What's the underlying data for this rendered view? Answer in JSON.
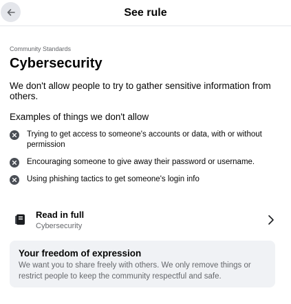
{
  "header": {
    "title": "See rule",
    "back_icon": "arrow-left-icon"
  },
  "rule": {
    "kicker": "Community Standards",
    "title": "Cybersecurity",
    "description": "We don't allow people to try to gather sensitive information from others.",
    "examples_heading": "Examples of things we don't allow",
    "examples": [
      {
        "icon": "x-circle-icon",
        "text": "Trying to get access to someone's accounts or data, with or without permission"
      },
      {
        "icon": "x-circle-icon",
        "text": "Encouraging someone to give away their password or username."
      },
      {
        "icon": "x-circle-icon",
        "text": "Using phishing tactics to get someone's login info"
      }
    ]
  },
  "read_full": {
    "title": "Read in full",
    "subtitle": "Cybersecurity",
    "icon": "book-icon",
    "chevron": "chevron-right-icon"
  },
  "freedom": {
    "title": "Your freedom of expression",
    "text": "We want you to share freely with others. We only remove things or restrict people to keep the community respectful and safe."
  },
  "colors": {
    "header_button_bg": "#e4e6eb",
    "icon_dark": "#4b4f56",
    "secondary_text": "#65676b",
    "card_bg": "#f0f2f5"
  }
}
